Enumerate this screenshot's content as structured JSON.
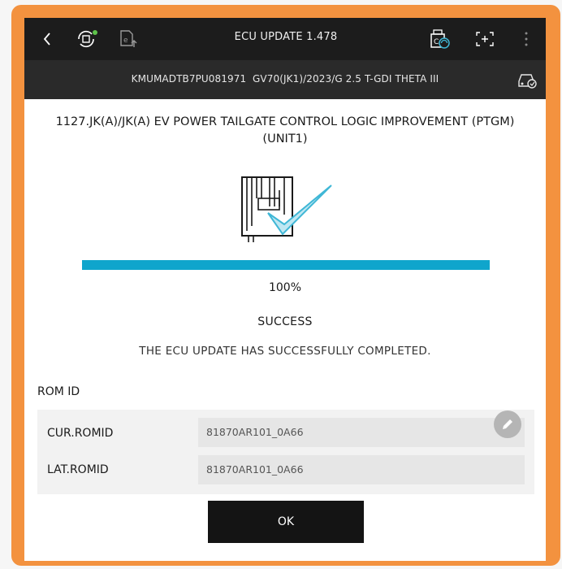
{
  "header": {
    "title": "ECU UPDATE 1.478",
    "icons": [
      "back-icon",
      "ecu-scan-icon",
      "document-upload-icon",
      "vci-connection-icon",
      "screenshot-icon",
      "more-icon"
    ]
  },
  "vehicle": {
    "info": "KMUMADTB7PU081971  GV70(JK1)/2023/G 2.5 T-GDI THETA III"
  },
  "update": {
    "title": "1127.JK(A)/JK(A) EV POWER TAILGATE CONTROL LOGIC IMPROVEMENT (PTGM) (UNIT1)",
    "progress": 100,
    "percent_text": "100%",
    "status": "SUCCESS",
    "message": "THE ECU UPDATE HAS SUCCESSFULLY COMPLETED."
  },
  "rom": {
    "heading": "ROM ID",
    "rows": [
      {
        "label": "CUR.ROMID",
        "value": "81870AR101_0A66"
      },
      {
        "label": "LAT.ROMID",
        "value": "81870AR101_0A66"
      }
    ]
  },
  "actions": {
    "ok_label": "OK"
  },
  "colors": {
    "frame": "#f3923f",
    "topbar": "#1c1c1c",
    "progress": "#0fa5cc",
    "check_accent": "#3fb7d6"
  }
}
